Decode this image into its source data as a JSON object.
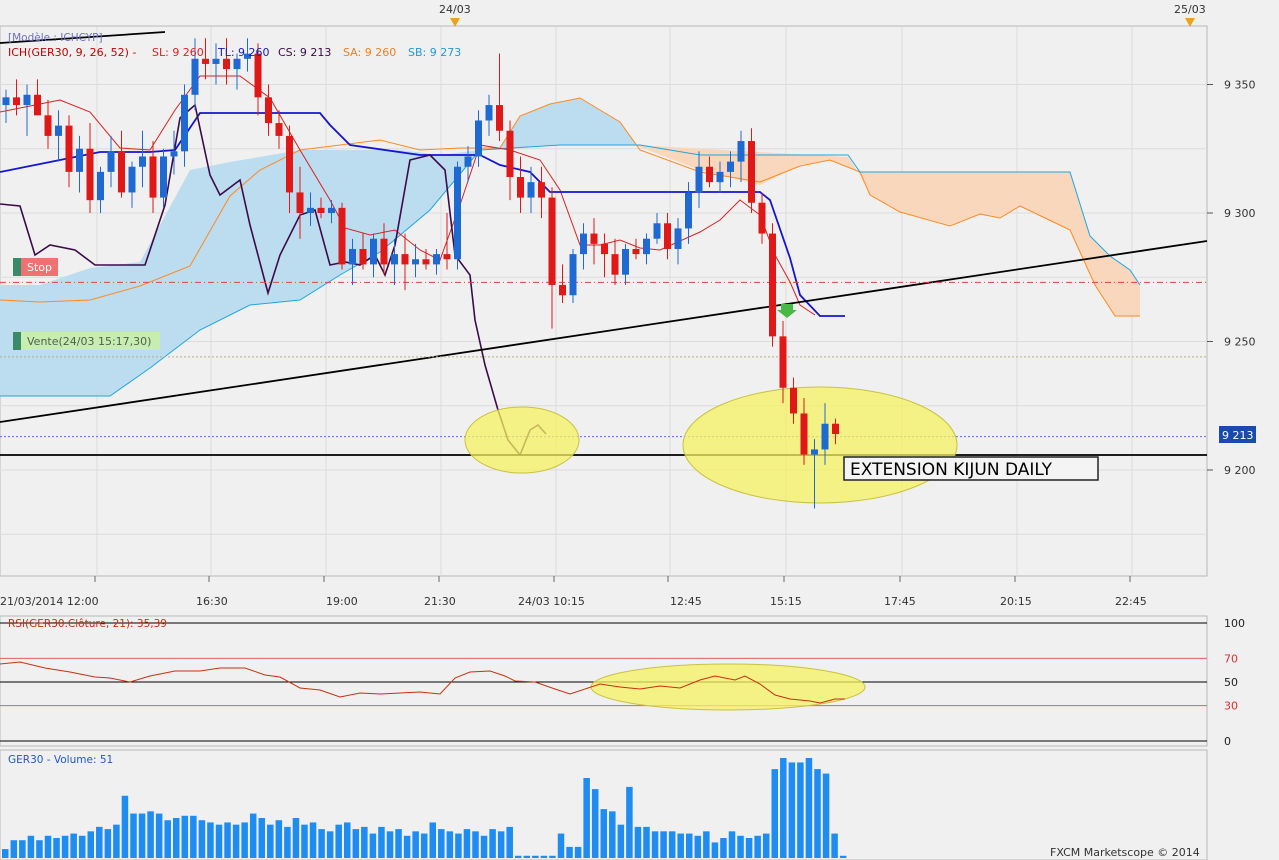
{
  "chart_data": {
    "type": "candlestick",
    "instrument": "GER30",
    "top_dates": [
      "24/03",
      "25/03"
    ],
    "x_tick_labels": [
      "21/03/2014 12:00",
      "16:30",
      "19:00",
      "21:30",
      "24/03 10:15",
      "12:45",
      "15:15",
      "17:45",
      "20:15",
      "22:45"
    ],
    "price_axis": {
      "ticks": [
        9200,
        9250,
        9300,
        9350
      ],
      "tick_labels": [
        "9 200",
        "9 250",
        "9 300",
        "9 350"
      ],
      "ylim": [
        9160,
        9370
      ],
      "current_price_label": "9 213",
      "current_price": 9213
    },
    "legend": {
      "model": "[Modèle : ICHCYP]",
      "ich": "ICH(GER30, 9, 26, 52) -",
      "sl": "SL: 9 260",
      "tl": "TL: 9 260",
      "cs": "CS: 9 213",
      "sa": "SA: 9 260",
      "sb": "SB: 9 273"
    },
    "markers": {
      "stop": "Stop",
      "sale": "Vente(24/03 15:17,30)",
      "stop_level": 9273,
      "sale_level": 9244
    },
    "annotation": "EXTENSION KIJUN DAILY",
    "candles": [
      [
        9342,
        9348,
        9335,
        9345
      ],
      [
        9345,
        9352,
        9338,
        9342
      ],
      [
        9342,
        9350,
        9330,
        9346
      ],
      [
        9346,
        9352,
        9340,
        9338
      ],
      [
        9338,
        9344,
        9325,
        9330
      ],
      [
        9330,
        9340,
        9320,
        9334
      ],
      [
        9334,
        9338,
        9310,
        9316
      ],
      [
        9316,
        9330,
        9308,
        9325
      ],
      [
        9325,
        9335,
        9300,
        9305
      ],
      [
        9305,
        9318,
        9300,
        9316
      ],
      [
        9316,
        9330,
        9310,
        9324
      ],
      [
        9324,
        9332,
        9306,
        9308
      ],
      [
        9308,
        9320,
        9302,
        9318
      ],
      [
        9318,
        9332,
        9310,
        9322
      ],
      [
        9322,
        9328,
        9300,
        9306
      ],
      [
        9306,
        9325,
        9302,
        9322
      ],
      [
        9322,
        9332,
        9315,
        9324
      ],
      [
        9324,
        9350,
        9318,
        9346
      ],
      [
        9346,
        9368,
        9340,
        9360
      ],
      [
        9360,
        9368,
        9352,
        9358
      ],
      [
        9358,
        9366,
        9350,
        9360
      ],
      [
        9360,
        9368,
        9350,
        9356
      ],
      [
        9356,
        9362,
        9348,
        9360
      ],
      [
        9360,
        9368,
        9355,
        9362
      ],
      [
        9362,
        9366,
        9338,
        9345
      ],
      [
        9345,
        9350,
        9330,
        9335
      ],
      [
        9335,
        9340,
        9325,
        9330
      ],
      [
        9330,
        9334,
        9300,
        9308
      ],
      [
        9308,
        9318,
        9290,
        9300
      ],
      [
        9300,
        9308,
        9295,
        9302
      ],
      [
        9302,
        9306,
        9298,
        9300
      ],
      [
        9300,
        9305,
        9296,
        9302
      ],
      [
        9302,
        9304,
        9278,
        9280
      ],
      [
        9280,
        9290,
        9272,
        9286
      ],
      [
        9286,
        9292,
        9278,
        9280
      ],
      [
        9280,
        9292,
        9275,
        9290
      ],
      [
        9290,
        9296,
        9276,
        9280
      ],
      [
        9280,
        9290,
        9272,
        9284
      ],
      [
        9284,
        9292,
        9270,
        9280
      ],
      [
        9280,
        9288,
        9275,
        9282
      ],
      [
        9282,
        9286,
        9278,
        9280
      ],
      [
        9280,
        9286,
        9276,
        9284
      ],
      [
        9284,
        9300,
        9278,
        9282
      ],
      [
        9282,
        9320,
        9278,
        9318
      ],
      [
        9318,
        9326,
        9312,
        9322
      ],
      [
        9322,
        9340,
        9318,
        9336
      ],
      [
        9336,
        9346,
        9330,
        9342
      ],
      [
        9342,
        9362,
        9328,
        9332
      ],
      [
        9332,
        9336,
        9305,
        9314
      ],
      [
        9314,
        9322,
        9300,
        9306
      ],
      [
        9306,
        9318,
        9300,
        9312
      ],
      [
        9312,
        9318,
        9298,
        9306
      ],
      [
        9306,
        9310,
        9255,
        9272
      ],
      [
        9272,
        9280,
        9265,
        9268
      ],
      [
        9268,
        9286,
        9265,
        9284
      ],
      [
        9284,
        9296,
        9278,
        9292
      ],
      [
        9292,
        9298,
        9280,
        9288
      ],
      [
        9288,
        9292,
        9275,
        9284
      ],
      [
        9284,
        9290,
        9272,
        9276
      ],
      [
        9276,
        9288,
        9272,
        9286
      ],
      [
        9286,
        9290,
        9282,
        9284
      ],
      [
        9284,
        9292,
        9280,
        9290
      ],
      [
        9290,
        9300,
        9288,
        9296
      ],
      [
        9296,
        9300,
        9282,
        9286
      ],
      [
        9286,
        9298,
        9280,
        9294
      ],
      [
        9294,
        9312,
        9288,
        9308
      ],
      [
        9308,
        9324,
        9302,
        9318
      ],
      [
        9318,
        9322,
        9310,
        9312
      ],
      [
        9312,
        9320,
        9308,
        9316
      ],
      [
        9316,
        9324,
        9310,
        9320
      ],
      [
        9320,
        9332,
        9312,
        9328
      ],
      [
        9328,
        9333,
        9300,
        9304
      ],
      [
        9304,
        9308,
        9288,
        9292
      ],
      [
        9292,
        9296,
        9248,
        9252
      ],
      [
        9252,
        9258,
        9226,
        9232
      ],
      [
        9232,
        9236,
        9218,
        9222
      ],
      [
        9222,
        9228,
        9202,
        9206
      ],
      [
        9206,
        9212,
        9185,
        9208
      ],
      [
        9208,
        9226,
        9202,
        9218
      ],
      [
        9218,
        9220,
        9210,
        9214
      ]
    ],
    "rsi": {
      "label": "RSI(GER30.Clôture, 21): 35,39",
      "levels": [
        100,
        70,
        50,
        30,
        0
      ],
      "level_labels": [
        "100",
        "70",
        "50",
        "30",
        "0"
      ]
    },
    "volume": {
      "label": "GER30 - Volume: 51",
      "values": [
        4,
        8,
        8,
        10,
        8,
        10,
        9,
        10,
        11,
        10,
        12,
        14,
        13,
        15,
        28,
        20,
        20,
        21,
        20,
        17,
        18,
        19,
        19,
        17,
        16,
        15,
        16,
        15,
        16,
        20,
        18,
        15,
        17,
        14,
        18,
        15,
        16,
        13,
        12,
        15,
        16,
        13,
        14,
        11,
        14,
        12,
        13,
        10,
        12,
        11,
        16,
        13,
        12,
        11,
        13,
        12,
        10,
        13,
        12,
        14,
        1,
        1,
        1,
        1,
        1,
        11,
        5,
        5,
        36,
        31,
        22,
        21,
        15,
        32,
        14,
        14,
        12,
        12,
        12,
        11,
        11,
        10,
        12,
        7,
        9,
        12,
        10,
        9,
        10,
        11,
        40,
        45,
        43,
        43,
        45,
        40,
        38,
        11,
        1
      ]
    },
    "footer": "FXCM Marketscope © 2014"
  }
}
